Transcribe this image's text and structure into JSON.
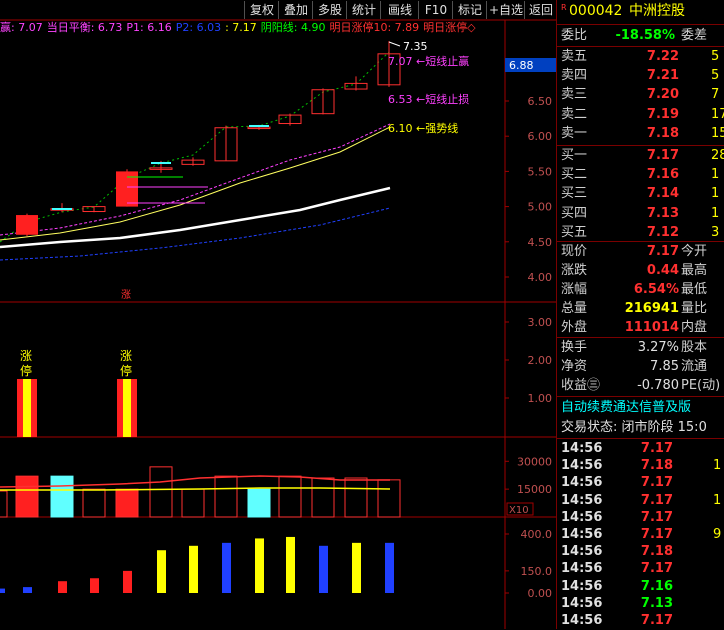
{
  "toolbar": {
    "buttons": [
      "复权",
      "叠加",
      "多股",
      "统计",
      "画线",
      "F10",
      "标记",
      "+自选",
      "返回"
    ]
  },
  "legend": {
    "items": [
      {
        "text": "赢: 7.07",
        "color": "#ff44ff"
      },
      {
        "text": "当日平衡: 6.73",
        "color": "#ff44ff"
      },
      {
        "text": "P1: 6.16",
        "color": "#ff44ff"
      },
      {
        "text": "P2: 6.03",
        "color": "#2040ff"
      },
      {
        "text": ": 7.17",
        "color": "#ffff00"
      },
      {
        "text": "阴阳线: 4.90",
        "color": "#00ff00"
      },
      {
        "text": "明日涨停10: 7.89",
        "color": "#ff3030"
      },
      {
        "text": "明日涨停◇",
        "color": "#ff3030"
      }
    ]
  },
  "main_chart": {
    "price_box": "6.88",
    "y_ticks": [
      "6.50",
      "6.00",
      "5.50",
      "5.00",
      "4.50",
      "4.00"
    ],
    "annotations": {
      "high_mark": "7.35",
      "take_profit": "7.07 ←短线止赢",
      "stop_loss": "6.53 ←短线止损",
      "trend_line": "6.10 ←强势线"
    },
    "zhang_marker": "涨"
  },
  "limit_panel": {
    "y_ticks": [
      "3.00",
      "2.00",
      "1.00"
    ],
    "labels": [
      "涨停",
      "涨停"
    ]
  },
  "volume_panel": {
    "y_ticks": [
      "30000",
      "15000"
    ],
    "unit": "X10"
  },
  "macd_panel": {
    "y_ticks": [
      "400.0",
      "150.0",
      "0.00"
    ]
  },
  "quote": {
    "code_prefix": "R",
    "code": "000042",
    "name": "中洲控股",
    "weibi_label": "委比",
    "weibi_value": "-18.58%",
    "weicha_label": "委差",
    "asks": [
      {
        "label": "卖五",
        "price": "7.22",
        "vol": "5"
      },
      {
        "label": "卖四",
        "price": "7.21",
        "vol": "5"
      },
      {
        "label": "卖三",
        "price": "7.20",
        "vol": "7"
      },
      {
        "label": "卖二",
        "price": "7.19",
        "vol": "17"
      },
      {
        "label": "卖一",
        "price": "7.18",
        "vol": "15"
      }
    ],
    "bids": [
      {
        "label": "买一",
        "price": "7.17",
        "vol": "28"
      },
      {
        "label": "买二",
        "price": "7.16",
        "vol": "1"
      },
      {
        "label": "买三",
        "price": "7.14",
        "vol": "1"
      },
      {
        "label": "买四",
        "price": "7.13",
        "vol": "1"
      },
      {
        "label": "买五",
        "price": "7.12",
        "vol": "3"
      }
    ],
    "stats": [
      {
        "l1": "现价",
        "v1": "7.17",
        "c1": "#ff3030",
        "l2": "今开"
      },
      {
        "l1": "涨跌",
        "v1": "0.44",
        "c1": "#ff3030",
        "l2": "最高"
      },
      {
        "l1": "涨幅",
        "v1": "6.54%",
        "c1": "#ff3030",
        "l2": "最低"
      },
      {
        "l1": "总量",
        "v1": "216941",
        "c1": "#ffff00",
        "l2": "量比"
      },
      {
        "l1": "外盘",
        "v1": "111014",
        "c1": "#ff3030",
        "l2": "内盘"
      }
    ],
    "stats2": [
      {
        "l1": "换手",
        "v1": "3.27%",
        "c1": "#e0e0e0",
        "l2": "股本"
      },
      {
        "l1": "净资",
        "v1": "7.85",
        "c1": "#e0e0e0",
        "l2": "流通"
      },
      {
        "l1": "收益㊂",
        "v1": "-0.780",
        "c1": "#e0e0e0",
        "l2": "PE(动)"
      }
    ],
    "ad_text": "自动续费通达信普及版",
    "trade_status": "交易状态: 闭市阶段 15:0",
    "ticks": [
      {
        "time": "14:56",
        "price": "7.17",
        "vol": "",
        "pc": "#ff3030"
      },
      {
        "time": "14:56",
        "price": "7.18",
        "vol": "1",
        "pc": "#ff3030"
      },
      {
        "time": "14:56",
        "price": "7.17",
        "vol": "",
        "pc": "#ff3030"
      },
      {
        "time": "14:56",
        "price": "7.17",
        "vol": "1",
        "pc": "#ff3030"
      },
      {
        "time": "14:56",
        "price": "7.17",
        "vol": "",
        "pc": "#ff3030"
      },
      {
        "time": "14:56",
        "price": "7.17",
        "vol": "9",
        "pc": "#ff3030"
      },
      {
        "time": "14:56",
        "price": "7.18",
        "vol": "",
        "pc": "#ff3030"
      },
      {
        "time": "14:56",
        "price": "7.17",
        "vol": "",
        "pc": "#ff3030"
      },
      {
        "time": "14:56",
        "price": "7.16",
        "vol": "",
        "pc": "#00ff00"
      },
      {
        "time": "14:56",
        "price": "7.13",
        "vol": "",
        "pc": "#00ff00"
      },
      {
        "time": "14:56",
        "price": "7.17",
        "vol": "",
        "pc": "#ff3030"
      }
    ]
  },
  "chart_data": {
    "type": "candlestick",
    "candles": [
      {
        "o": 4.6,
        "h": 4.9,
        "l": 4.58,
        "c": 4.88,
        "up": true,
        "limit": true
      },
      {
        "o": 4.95,
        "h": 5.05,
        "l": 4.92,
        "c": 4.97,
        "up": true
      },
      {
        "o": 4.93,
        "h": 5.0,
        "l": 4.92,
        "c": 5.0,
        "up": true
      },
      {
        "o": 5.0,
        "h": 5.53,
        "l": 5.0,
        "c": 5.5,
        "up": true,
        "limit": true
      },
      {
        "o": 5.55,
        "h": 5.65,
        "l": 5.48,
        "c": 5.55,
        "up": true
      },
      {
        "o": 5.6,
        "h": 5.7,
        "l": 5.58,
        "c": 5.66,
        "up": true
      },
      {
        "o": 5.65,
        "h": 6.15,
        "l": 5.65,
        "c": 6.12,
        "up": true
      },
      {
        "o": 6.13,
        "h": 6.16,
        "l": 6.09,
        "c": 6.13,
        "up": true
      },
      {
        "o": 6.18,
        "h": 6.32,
        "l": 6.15,
        "c": 6.3,
        "up": true
      },
      {
        "o": 6.32,
        "h": 6.68,
        "l": 6.31,
        "c": 6.66,
        "up": true
      },
      {
        "o": 6.67,
        "h": 6.85,
        "l": 6.65,
        "c": 6.75,
        "up": true
      },
      {
        "o": 6.73,
        "h": 7.35,
        "l": 6.7,
        "c": 7.17,
        "up": true
      }
    ],
    "volumes": [
      22000,
      22000,
      15000,
      15000,
      27000,
      15000,
      22000,
      15000,
      22000,
      21000,
      21000,
      20000
    ],
    "vol_colors": [
      "r",
      "c",
      "r",
      "r",
      "r",
      "r",
      "r",
      "c",
      "r",
      "r",
      "r",
      "r"
    ],
    "macd": [
      40,
      80,
      100,
      150,
      290,
      320,
      340,
      370,
      380,
      320,
      340,
      340
    ],
    "macd_colors": [
      "#2040ff",
      "#ff2020",
      "#ff2020",
      "#ff2020",
      "#ffff00",
      "#ffff00",
      "#2040ff",
      "#ffff00",
      "#ffff00",
      "#2040ff",
      "#ffff00",
      "#2040ff"
    ]
  }
}
